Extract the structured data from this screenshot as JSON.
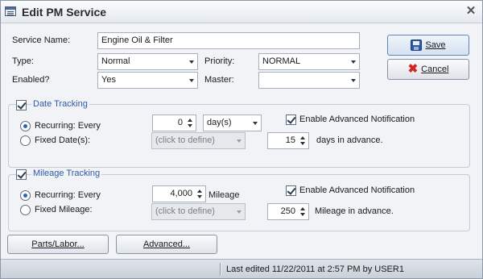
{
  "window": {
    "title": "Edit PM Service",
    "close_glyph": "✕"
  },
  "form": {
    "service_name_label": "Service Name:",
    "service_name_value": "Engine Oil & Filter",
    "type_label": "Type:",
    "type_value": "Normal",
    "priority_label": "Priority:",
    "priority_value": "NORMAL",
    "enabled_label": "Enabled?",
    "enabled_value": "Yes",
    "master_label": "Master:",
    "master_value": ""
  },
  "buttons": {
    "save_label": "Save",
    "cancel_label": "Cancel",
    "parts_labor_label": "Parts/Labor...",
    "advanced_label": "Advanced..."
  },
  "date_tracking": {
    "title": "Date Tracking",
    "checked": true,
    "recurring_label": "Recurring: Every",
    "recurring_selected": true,
    "recurring_value": "0",
    "unit_value": "day(s)",
    "fixed_label": "Fixed Date(s):",
    "fixed_value": "(click to define)",
    "notify_label": "Enable Advanced Notification",
    "notify_checked": true,
    "advance_value": "15",
    "advance_suffix": "days in advance."
  },
  "mileage_tracking": {
    "title": "Mileage Tracking",
    "checked": true,
    "recurring_label": "Recurring: Every",
    "recurring_selected": true,
    "recurring_value": "4,000",
    "recurring_suffix": "Mileage",
    "fixed_label": "Fixed Mileage:",
    "fixed_value": "(click to define)",
    "notify_label": "Enable Advanced Notification",
    "notify_checked": true,
    "advance_value": "250",
    "advance_suffix": "Mileage in advance."
  },
  "status": {
    "text": "Last edited 11/22/2011 at 2:57 PM by USER1"
  },
  "icons": {
    "window": "window-app-icon",
    "close": "close-icon",
    "save": "floppy-disk-icon",
    "cancel": "red-x-icon"
  }
}
